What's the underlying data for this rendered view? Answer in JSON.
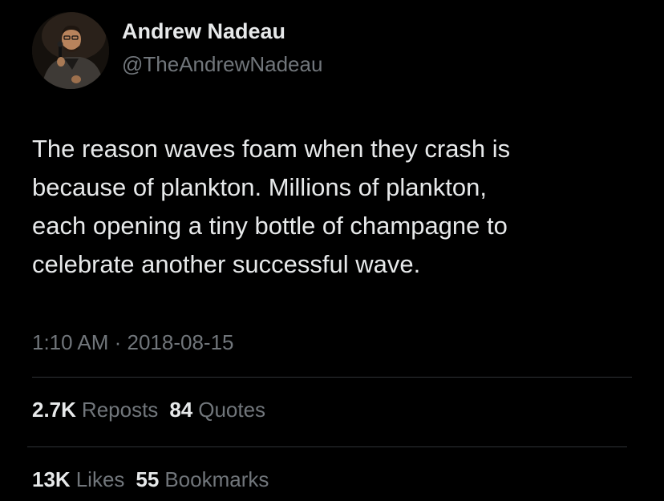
{
  "author": {
    "display_name": "Andrew Nadeau",
    "handle": "@TheAndrewNadeau"
  },
  "tweet": {
    "text_lines": [
      "The reason waves foam when they crash is",
      "because of plankton. Millions of plankton,",
      "each opening a tiny bottle of champagne to",
      "celebrate another successful wave."
    ],
    "timestamp": "1:10 AM · 2018-08-15"
  },
  "stats": {
    "reposts": {
      "count": "2.7K",
      "label": "Reposts"
    },
    "quotes": {
      "count": "84",
      "label": "Quotes"
    },
    "likes": {
      "count": "13K",
      "label": "Likes"
    },
    "bookmarks": {
      "count": "55",
      "label": "Bookmarks"
    }
  },
  "colors": {
    "background": "#000000",
    "primary_text": "#e7e9ea",
    "secondary_text": "#71767b",
    "divider": "#2f3336"
  }
}
